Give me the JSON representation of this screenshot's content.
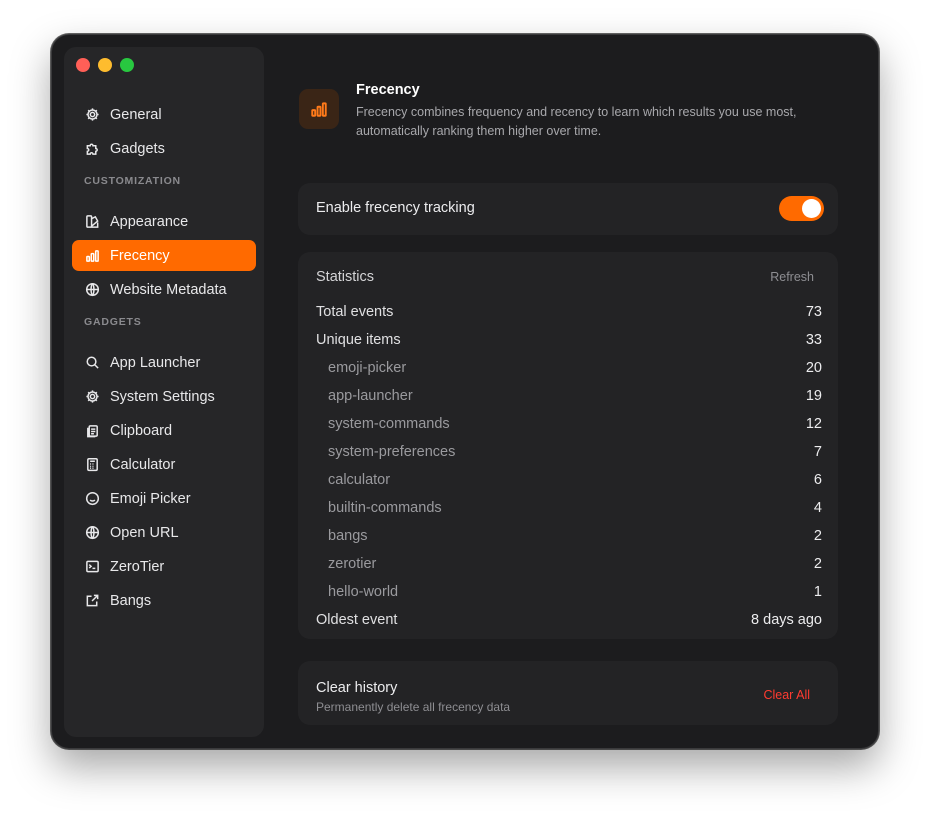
{
  "sidebar": {
    "top_items": [
      {
        "label": "General",
        "icon": "gear-icon"
      },
      {
        "label": "Gadgets",
        "icon": "puzzle-icon"
      }
    ],
    "customization_label": "CUSTOMIZATION",
    "customization_items": [
      {
        "label": "Appearance",
        "icon": "palette-icon"
      },
      {
        "label": "Frecency",
        "icon": "bar-chart-icon",
        "active": true
      },
      {
        "label": "Website Metadata",
        "icon": "globe-icon"
      }
    ],
    "gadgets_label": "GADGETS",
    "gadget_items": [
      {
        "label": "App Launcher",
        "icon": "search-icon"
      },
      {
        "label": "System Settings",
        "icon": "gear-icon"
      },
      {
        "label": "Clipboard",
        "icon": "clipboard-icon"
      },
      {
        "label": "Calculator",
        "icon": "calculator-icon"
      },
      {
        "label": "Emoji Picker",
        "icon": "smiley-icon"
      },
      {
        "label": "Open URL",
        "icon": "globe-icon"
      },
      {
        "label": "ZeroTier",
        "icon": "terminal-icon"
      },
      {
        "label": "Bangs",
        "icon": "external-link-icon"
      }
    ]
  },
  "header": {
    "title": "Frecency",
    "description": "Frecency combines frequency and recency to learn which results you use most, automatically ranking them higher over time."
  },
  "tracking": {
    "label": "Enable frecency tracking",
    "enabled": true
  },
  "statistics": {
    "title": "Statistics",
    "refresh_label": "Refresh",
    "total_events": {
      "label": "Total events",
      "value": "73"
    },
    "unique_items": {
      "label": "Unique items",
      "value": "33"
    },
    "items": [
      {
        "label": "emoji-picker",
        "value": "20"
      },
      {
        "label": "app-launcher",
        "value": "19"
      },
      {
        "label": "system-commands",
        "value": "12"
      },
      {
        "label": "system-preferences",
        "value": "7"
      },
      {
        "label": "calculator",
        "value": "6"
      },
      {
        "label": "builtin-commands",
        "value": "4"
      },
      {
        "label": "bangs",
        "value": "2"
      },
      {
        "label": "zerotier",
        "value": "2"
      },
      {
        "label": "hello-world",
        "value": "1"
      }
    ],
    "oldest_event": {
      "label": "Oldest event",
      "value": "8 days ago"
    }
  },
  "clear_history": {
    "title": "Clear history",
    "description": "Permanently delete all frecency data",
    "button_label": "Clear All"
  },
  "colors": {
    "accent": "#ff6a00",
    "danger": "#ff3b30",
    "background": "#1c1c1e"
  }
}
